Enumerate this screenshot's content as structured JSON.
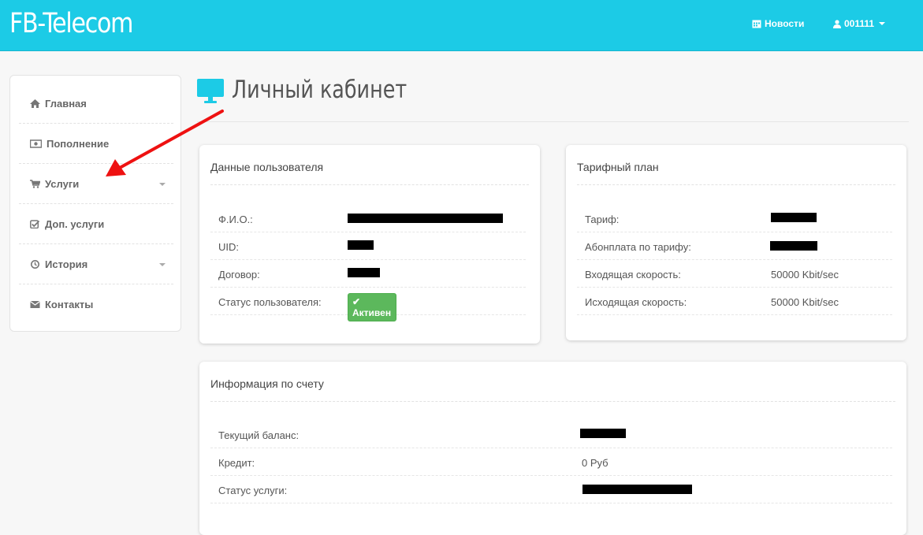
{
  "brand": "FB-Telecom",
  "topnav": {
    "news_label": "Новости",
    "user_label": "001111"
  },
  "sidebar": {
    "items": [
      {
        "label": "Главная",
        "icon": "home-icon"
      },
      {
        "label": "Пополнение",
        "icon": "money-icon"
      },
      {
        "label": "Услуги",
        "icon": "cart-icon",
        "has_submenu": true
      },
      {
        "label": "Доп. услуги",
        "icon": "checkbox-icon"
      },
      {
        "label": "История",
        "icon": "clock-icon",
        "has_submenu": true
      },
      {
        "label": "Контакты",
        "icon": "envelope-icon"
      }
    ]
  },
  "page_title": "Личный кабинет",
  "user_panel": {
    "title": "Данные пользователя",
    "rows": [
      {
        "label": "Ф.И.О.:"
      },
      {
        "label": "UID:"
      },
      {
        "label": "Договор:"
      },
      {
        "label": "Статус пользователя:",
        "badge": "Активен"
      }
    ]
  },
  "tariff_panel": {
    "title": "Тарифный план",
    "rows": [
      {
        "label": "Тариф:"
      },
      {
        "label": "Абонплата по тарифу:"
      },
      {
        "label": "Входящая скорость:",
        "value": "50000 Kbit/sec"
      },
      {
        "label": "Исходящая скорость:",
        "value": "50000 Kbit/sec"
      }
    ]
  },
  "account_panel": {
    "title": "Информация по счету",
    "rows": [
      {
        "label": "Текущий баланс:"
      },
      {
        "label": "Кредит:",
        "value": "0 Руб"
      },
      {
        "label": "Статус услуги:"
      }
    ]
  },
  "colors": {
    "navbar": "#1ccbe6",
    "accent": "#1ccbe6",
    "success": "#5cb85c",
    "annotation_arrow": "#ee1111"
  }
}
